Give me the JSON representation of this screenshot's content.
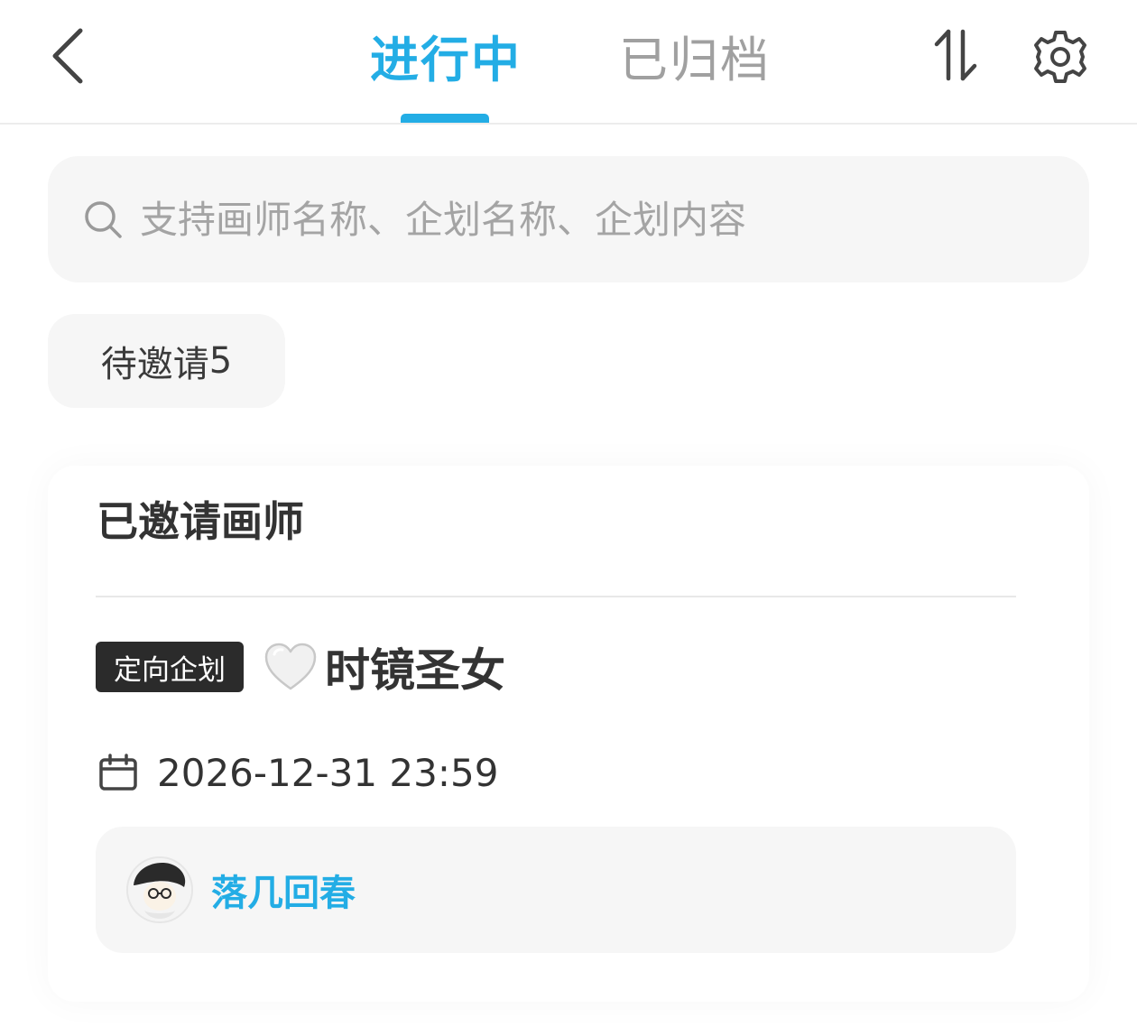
{
  "header": {
    "tabs": [
      {
        "label": "进行中",
        "active": true
      },
      {
        "label": "已归档",
        "active": false
      }
    ],
    "accent_color": "#23ade5",
    "icons": [
      "chevron-left-icon",
      "sort-icon",
      "gear-icon"
    ]
  },
  "search": {
    "placeholder": "支持画师名称、企划名称、企划内容",
    "value": ""
  },
  "filter": {
    "label": "待邀请",
    "count": "5"
  },
  "invited": {
    "section_title": "已邀请画师",
    "project": {
      "tag": "定向企划",
      "title": "时镜圣女",
      "heart_icon": "white-heart-icon",
      "deadline": "2026-12-31 23:59"
    },
    "artist": {
      "name": "落几回春"
    }
  }
}
